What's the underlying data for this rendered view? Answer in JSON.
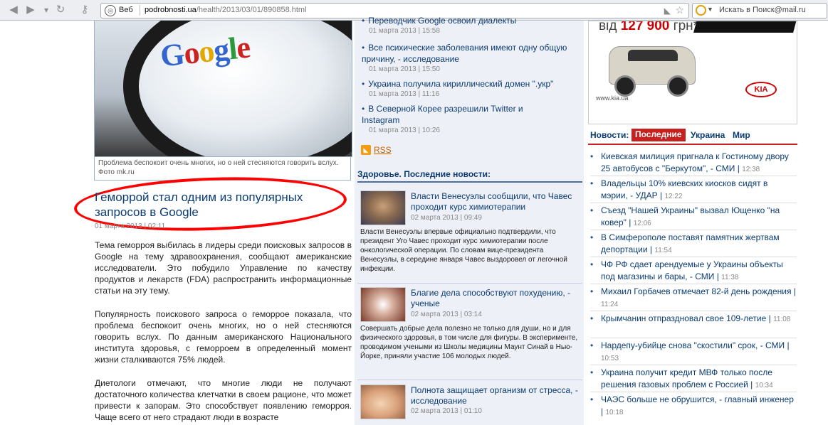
{
  "browser": {
    "search_kind": "Веб",
    "url_host": "podrobnosti.ua",
    "url_path": "/health/2013/03/01/890858.html",
    "search_placeholder": "Искать в Поиск@mail.ru"
  },
  "article": {
    "image_alt_logo": "Google",
    "photo_caption": "Проблема беспокоит очень многих, но о ней стесняются говорить вслух. Фото mk.ru",
    "title": "Геморрой стал одним из популярных запросов в Google",
    "date": "01 марта 2013 | 02:11",
    "paragraphs": [
      "Тема геморроя выбилась в лидеры среди поисковых запросов в Google на тему здравоохранения, сообщают американские исследователи. Это побудило Управление по качеству продуктов и лекарств (FDA) распространить информационные статьи на эту тему.",
      "Популярность поискового запроса о геморрое показала, что проблема беспокоит очень многих, но о ней стесняются говорить вслух. По данным американского Национального института здоровья, с геморроем в определенный момент жизни сталкиваются 75% людей.",
      "Диетологи отмечают, что многие люди не получают достаточного количества клетчатки в своем рационе, что может привести к запорам. Это способствует появлению геморроя. Чаще всего от него страдают люди в возрасте"
    ]
  },
  "related": [
    {
      "title": "Переводчик Google освоил диалекты",
      "date": "01 марта 2013 | 15:58"
    },
    {
      "title": "Все психические заболевания имеют одну общую причину, - исследование",
      "date": "01 марта 2013 | 15:50"
    },
    {
      "title": "Украина получила кириллический домен \".укр\"",
      "date": "01 марта 2013 | 11:16"
    },
    {
      "title": "В Северной Корее разрешили Twitter и Instagram",
      "date": "01 марта 2013 | 10:26"
    }
  ],
  "rss_label": "RSS",
  "health": {
    "heading": "Здоровье. Последние новости:",
    "items": [
      {
        "title": "Власти Венесуэлы сообщили, что Чавес проходит курс химиотерапии",
        "date": "02 марта 2013 | 09:49",
        "desc": "Власти Венесуэлы впервые официально подтвердили, что президент Уго Чавес проходит курс химиотерапии после онкологической операции. По словам вице-президента Венесуэлы, в середине января Чавес выздоровел от легочной инфекции."
      },
      {
        "title": "Благие дела способствуют похудению, - ученые",
        "date": "02 марта 2013 | 03:14",
        "desc": "Совершать добрые дела полезно не только для души, но и для физического здоровья, в том числе для фигуры. В эксперименте, проводимом учеными из Школы медицины Маунт Синай в Нью-Йорке, приняли участие 106 молодых людей."
      },
      {
        "title": "Полнота защищает организм от стресса, - исследование",
        "date": "02 марта 2013 | 01:10",
        "desc": ""
      }
    ]
  },
  "ad": {
    "price_prefix": "від",
    "price_value": "127 900",
    "price_suffix": "грн*",
    "site": "www.kia.ua",
    "brand": "KIA"
  },
  "news_tabs": {
    "label": "Новости:",
    "tabs": [
      "Последние",
      "Украина",
      "Мир"
    ]
  },
  "news": [
    {
      "title": "Киевская милиция пригнала к Гостиному двору 25 автобусов с \"Беркутом\", - СМИ",
      "time": "12:38"
    },
    {
      "title": "Владельцы 10% киевских киосков сидят в мэрии, - УДАР",
      "time": "12:22"
    },
    {
      "title": "Съезд \"Нашей Украины\" вызвал Ющенко \"на ковер\"",
      "time": "12:06"
    },
    {
      "title": "В Симферополе поставят памятник жертвам депортации",
      "time": "11:54"
    },
    {
      "title": "ЧФ РФ сдает арендуемые у Украины объекты под магазины и бары, - СМИ",
      "time": "11:38"
    },
    {
      "title": "Михаил Горбачев отмечает 82-й день рождения",
      "time": "11:24"
    },
    {
      "title": "Крымчанин отпраздновал свое 109-летие",
      "time": "11:08"
    },
    {
      "title": "Нардепу-убийце снова \"скостили\" срок, - СМИ",
      "time": "10:53"
    },
    {
      "title": "Украина получит кредит МВФ только после решения газовых проблем с Россией",
      "time": "10:34"
    },
    {
      "title": "ЧАЭС больше не обрушится, - главный инженер",
      "time": "10:18"
    }
  ]
}
